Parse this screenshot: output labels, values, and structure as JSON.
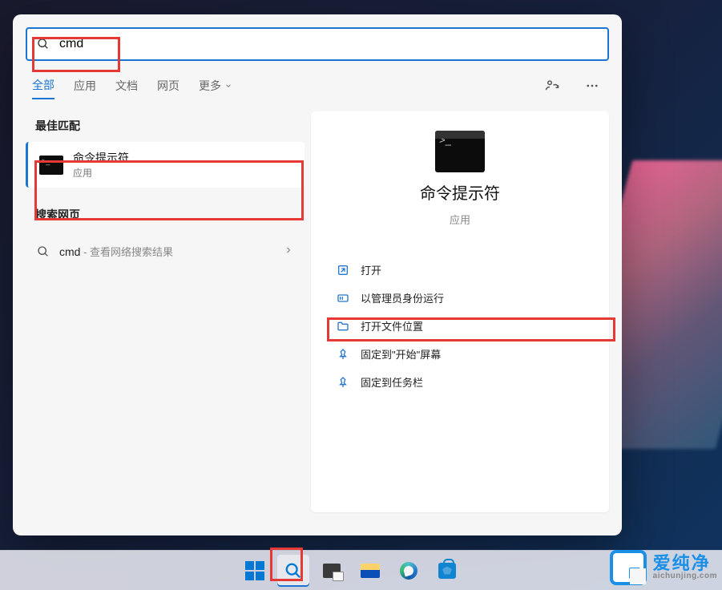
{
  "search": {
    "value": "cmd"
  },
  "tabs": {
    "all": "全部",
    "apps": "应用",
    "docs": "文档",
    "web": "网页",
    "more": "更多"
  },
  "sections": {
    "best": "最佳匹配",
    "web": "搜索网页"
  },
  "bestMatch": {
    "name": "命令提示符",
    "kind": "应用"
  },
  "webResults": [
    {
      "term": "cmd",
      "hint": " - 查看网络搜索结果"
    }
  ],
  "preview": {
    "title": "命令提示符",
    "kind": "应用"
  },
  "actions": {
    "open": "打开",
    "runAdmin": "以管理员身份运行",
    "openLocation": "打开文件位置",
    "pinStart": "固定到\"开始\"屏幕",
    "pinTaskbar": "固定到任务栏"
  },
  "watermark": {
    "cn": "爱纯净",
    "en": "aichunjing.com"
  }
}
